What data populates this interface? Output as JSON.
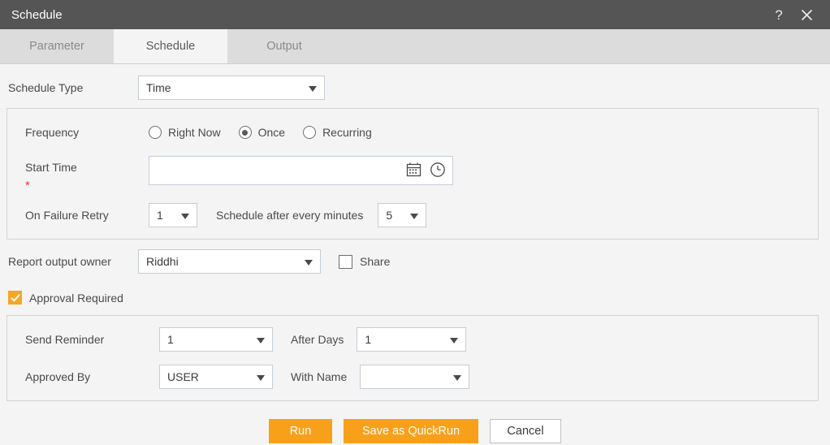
{
  "window": {
    "title": "Schedule",
    "help_label": "?",
    "close_label": "✕"
  },
  "tabs": [
    {
      "label": "Parameter",
      "active": false
    },
    {
      "label": "Schedule",
      "active": true
    },
    {
      "label": "Output",
      "active": false
    }
  ],
  "schedule_type": {
    "label": "Schedule Type",
    "value": "Time"
  },
  "frequency": {
    "label": "Frequency",
    "options": [
      {
        "label": "Right Now",
        "selected": false
      },
      {
        "label": "Once",
        "selected": true
      },
      {
        "label": "Recurring",
        "selected": false
      }
    ]
  },
  "start_time": {
    "label": "Start Time",
    "required_marker": "*",
    "value": "",
    "placeholder": "",
    "calendar_icon": "calendar-icon",
    "clock_icon": "clock-icon"
  },
  "on_failure_retry": {
    "label": "On Failure Retry",
    "value": "1"
  },
  "schedule_after": {
    "label": "Schedule after every minutes",
    "value": "5"
  },
  "report_output_owner": {
    "label": "Report output owner",
    "value": "Riddhi"
  },
  "share": {
    "label": "Share",
    "checked": false
  },
  "approval_required": {
    "label": "Approval Required",
    "checked": true
  },
  "send_reminder": {
    "label": "Send Reminder",
    "value": "1"
  },
  "after_days": {
    "label": "After Days",
    "value": "1"
  },
  "approved_by": {
    "label": "Approved By",
    "value": "USER"
  },
  "with_name": {
    "label": "With Name",
    "value": ""
  },
  "buttons": {
    "run": "Run",
    "save_quickrun": "Save as QuickRun",
    "cancel": "Cancel"
  },
  "colors": {
    "titlebar": "#555555",
    "tabbar": "#dcdcdc",
    "accent_orange": "#f9a01b",
    "checkbox_orange": "#f5a623",
    "required_red": "#e03a2f",
    "page_bg": "#f4f4f4"
  }
}
